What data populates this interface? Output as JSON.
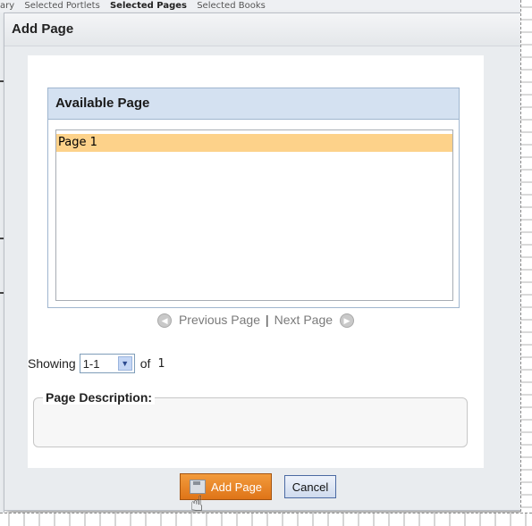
{
  "background_tabs": [
    "ary",
    "Selected Portlets",
    "Selected Pages",
    "Selected Books"
  ],
  "dialog": {
    "title": "Add Page"
  },
  "available": {
    "header": "Available Page",
    "items": [
      {
        "label": "Page 1",
        "selected": true
      }
    ]
  },
  "pager": {
    "prev_label": "Previous Page",
    "separator": "|",
    "next_label": "Next Page",
    "prev_icon": "left-arrow-circle-icon",
    "next_icon": "right-arrow-circle-icon"
  },
  "showing": {
    "label": "Showing",
    "range_value": "1-1",
    "of_label": "of",
    "total": "1"
  },
  "description": {
    "legend": "Page Description:"
  },
  "buttons": {
    "add_label": "Add Page",
    "cancel_label": "Cancel"
  },
  "colors": {
    "accent_orange": "#df7418",
    "header_blue": "#d4e1f1",
    "selected_row": "#fdd28a"
  }
}
